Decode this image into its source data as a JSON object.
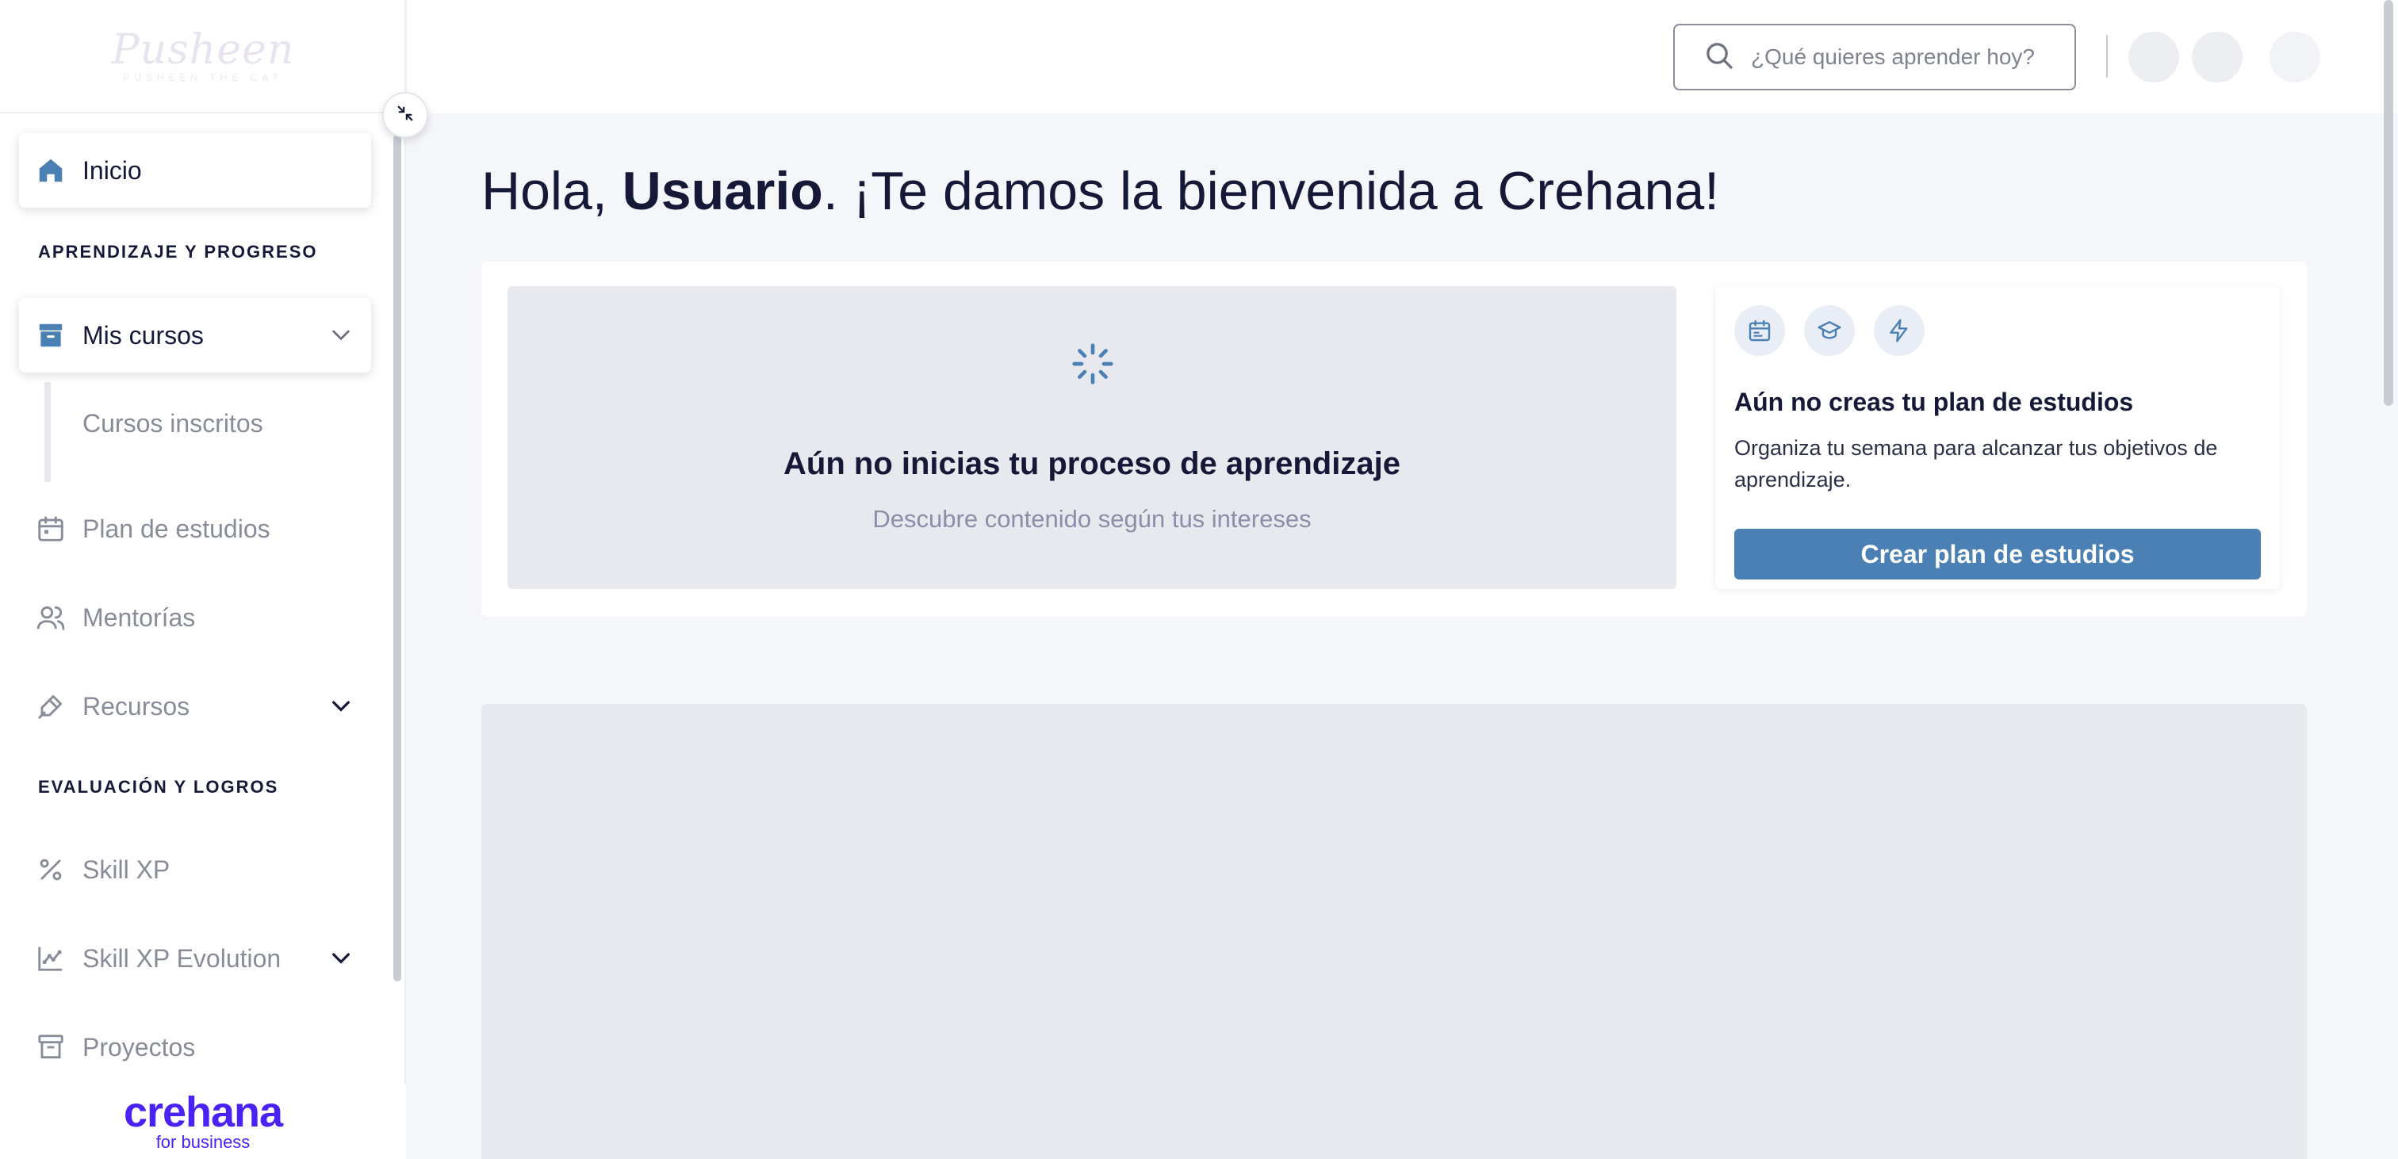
{
  "brand": {
    "name": "Pusheen",
    "tagline": "PUSHEEN THE CAT"
  },
  "sidebar": {
    "home": {
      "label": "Inicio",
      "icon": "home-icon"
    },
    "section_learning": "APRENDIZAJE Y PROGRESO",
    "my_courses": {
      "label": "Mis cursos",
      "icon": "archive-icon",
      "expanded": true
    },
    "enrolled_courses": "Cursos inscritos",
    "study_plan": {
      "label": "Plan de estudios",
      "icon": "calendar-icon"
    },
    "mentoring": {
      "label": "Mentorías",
      "icon": "users-icon"
    },
    "resources": {
      "label": "Recursos",
      "icon": "tools-icon"
    },
    "section_evaluation": "EVALUACIÓN Y LOGROS",
    "skill_xp": {
      "label": "Skill XP",
      "icon": "percent-icon"
    },
    "skill_xp_evolution": {
      "label": "Skill XP Evolution",
      "icon": "chart-icon"
    },
    "projects": {
      "label": "Proyectos",
      "icon": "archive-icon"
    },
    "footer": {
      "logo": "crehana",
      "sub": "for business"
    }
  },
  "header": {
    "search_placeholder": "¿Qué quieres aprender hoy?"
  },
  "main": {
    "greeting_prefix": "Hola, ",
    "greeting_name": "Usuario",
    "greeting_suffix": ". ¡Te damos la bienvenida a Crehana!",
    "empty_title": "Aún no inicias tu proceso de aprendizaje",
    "empty_subtitle": "Descubre contenido según tus intereses",
    "plan_title": "Aún no creas tu plan de estudios",
    "plan_description": "Organiza tu semana para alcanzar tus objetivos de aprendizaje.",
    "plan_button": "Crear plan de estudios"
  },
  "colors": {
    "accent": "#4b80b4",
    "brand_crehana": "#4b22f4",
    "text_dark": "#151836",
    "muted": "#888c98"
  }
}
